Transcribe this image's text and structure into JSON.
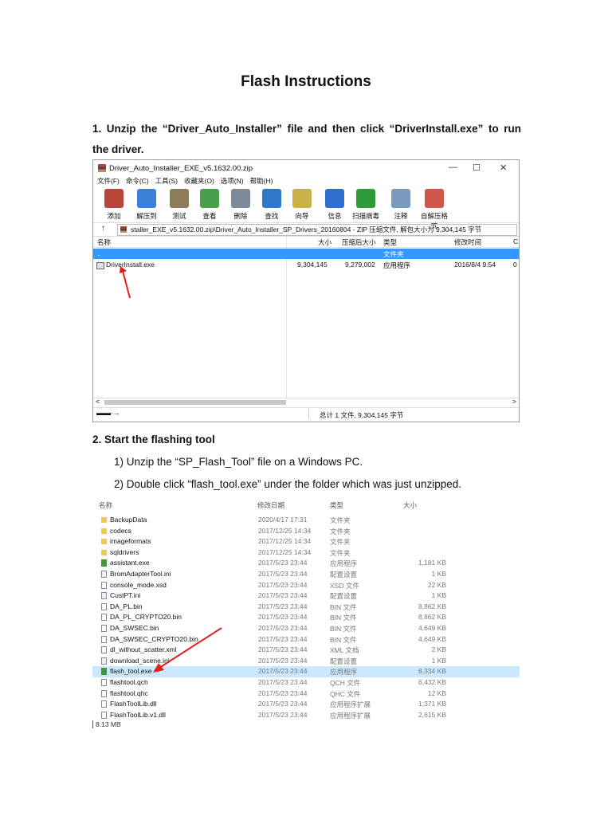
{
  "title": "Flash Instructions",
  "step1": {
    "line1": "1. Unzip the “Driver_Auto_Installer” file and then click “DriverInstall.exe” to run",
    "line2": "the driver."
  },
  "winrar": {
    "window_title": "Driver_Auto_Installer_EXE_v5.1632.00.zip",
    "controls": {
      "minimize": "—",
      "maximize": "☐",
      "close": "✕"
    },
    "menu": [
      "文件(F)",
      "命令(C)",
      "工具(S)",
      "收藏夹(O)",
      "选项(N)",
      "帮助(H)"
    ],
    "toolbar": [
      {
        "label": "添加",
        "icon": "add-archive-icon",
        "color": "#b7463a"
      },
      {
        "label": "解压到",
        "icon": "extract-folder-icon",
        "color": "#3b7fd6"
      },
      {
        "label": "测试",
        "icon": "test-clipboard-icon",
        "color": "#8e7b5a"
      },
      {
        "label": "查看",
        "icon": "view-book-icon",
        "color": "#4aa04a"
      },
      {
        "label": "删除",
        "icon": "delete-trash-icon",
        "color": "#7d8a99"
      },
      {
        "label": "查找",
        "icon": "find-magnifier-icon",
        "color": "#2f78c8"
      },
      {
        "label": "向导",
        "icon": "wizard-wand-icon",
        "color": "#c9b14a"
      },
      {
        "label": "信息",
        "icon": "info-icon",
        "color": "#2f6fd0"
      },
      {
        "label": "扫描病毒",
        "icon": "virus-scan-icon",
        "color": "#2e9b3a"
      },
      {
        "label": "注释",
        "icon": "comment-icon",
        "color": "#7a9bbf"
      },
      {
        "label": "自解压格式",
        "icon": "sfx-icon",
        "color": "#d0564a"
      }
    ],
    "up_arrow": "↑",
    "address": "staller_EXE_v5.1632.00.zip\\Driver_Auto_Installer_SP_Drivers_20160804 - ZIP 压缩文件, 解包大小为 9,304,145 字节",
    "columns": {
      "name": "名称",
      "size": "大小",
      "packed": "压缩后大小",
      "type": "类型",
      "modified": "修改时间",
      "crc": "C"
    },
    "rows": [
      {
        "name": "..",
        "size": "",
        "packed": "",
        "type": "文件夹",
        "modified": "",
        "crc": ""
      },
      {
        "name": "DriverInstall.exe",
        "size": "9,304,145",
        "packed": "9,279,002",
        "type": "应用程序",
        "modified": "2016/8/4 9:54",
        "crc": "0"
      }
    ],
    "scroll_left": "<",
    "scroll_right": ">",
    "drive_icon": "▬▬∙→",
    "status": "总计 1 文件, 9,304,145 字节"
  },
  "step2": {
    "heading": "2.  Start the flashing tool",
    "sub1": "1)  Unzip the “SP_Flash_Tool” file on a Windows PC.",
    "sub2": "2)  Double click “flash_tool.exe” under the folder which was just unzipped."
  },
  "explorer": {
    "columns": {
      "name": "名称",
      "modified": "修改日期",
      "type": "类型",
      "size": "大小"
    },
    "rows": [
      {
        "name": "BackupData",
        "date": "2020/4/17 17:31",
        "type": "文件夹",
        "size": "",
        "kind": "folder"
      },
      {
        "name": "codecs",
        "date": "2017/12/25 14:34",
        "type": "文件夹",
        "size": "",
        "kind": "folder"
      },
      {
        "name": "imageformats",
        "date": "2017/12/25 14:34",
        "type": "文件夹",
        "size": "",
        "kind": "folder"
      },
      {
        "name": "sqldrivers",
        "date": "2017/12/25 14:34",
        "type": "文件夹",
        "size": "",
        "kind": "folder"
      },
      {
        "name": "assistant.exe",
        "date": "2017/5/23 23:44",
        "type": "应用程序",
        "size": "1,181 KB",
        "kind": "exe"
      },
      {
        "name": "BromAdapterTool.ini",
        "date": "2017/5/23 23:44",
        "type": "配置设置",
        "size": "1 KB",
        "kind": "cfg"
      },
      {
        "name": "console_mode.xsd",
        "date": "2017/5/23 23:44",
        "type": "XSD 文件",
        "size": "22 KB",
        "kind": "file"
      },
      {
        "name": "CustPT.ini",
        "date": "2017/5/23 23:44",
        "type": "配置设置",
        "size": "1 KB",
        "kind": "cfg"
      },
      {
        "name": "DA_PL.bin",
        "date": "2017/5/23 23:44",
        "type": "BIN 文件",
        "size": "8,862 KB",
        "kind": "file"
      },
      {
        "name": "DA_PL_CRYPTO20.bin",
        "date": "2017/5/23 23:44",
        "type": "BIN 文件",
        "size": "8,862 KB",
        "kind": "file"
      },
      {
        "name": "DA_SWSEC.bin",
        "date": "2017/5/23 23:44",
        "type": "BIN 文件",
        "size": "4,649 KB",
        "kind": "file"
      },
      {
        "name": "DA_SWSEC_CRYPTO20.bin",
        "date": "2017/5/23 23:44",
        "type": "BIN 文件",
        "size": "4,649 KB",
        "kind": "file"
      },
      {
        "name": "dl_without_scatter.xml",
        "date": "2017/5/23 23:44",
        "type": "XML 文档",
        "size": "2 KB",
        "kind": "file"
      },
      {
        "name": "download_scene.ini",
        "date": "2017/5/23 23:44",
        "type": "配置设置",
        "size": "1 KB",
        "kind": "cfg"
      },
      {
        "name": "flash_tool.exe",
        "date": "2017/5/23 23:44",
        "type": "应用程序",
        "size": "8,334 KB",
        "kind": "exe",
        "selected": true
      },
      {
        "name": "flashtool.qch",
        "date": "2017/5/23 23:44",
        "type": "QCH 文件",
        "size": "6,432 KB",
        "kind": "file"
      },
      {
        "name": "flashtool.qhc",
        "date": "2017/5/23 23:44",
        "type": "QHC 文件",
        "size": "12 KB",
        "kind": "file"
      },
      {
        "name": "FlashToolLib.dll",
        "date": "2017/5/23 23:44",
        "type": "应用程序扩展",
        "size": "1,371 KB",
        "kind": "file"
      },
      {
        "name": "FlashToolLib.v1.dll",
        "date": "2017/5/23 23:44",
        "type": "应用程序扩展",
        "size": "2,615 KB",
        "kind": "file"
      }
    ],
    "footer": "8.13 MB"
  },
  "colors": {
    "selection_blue": "#3399ff",
    "explorer_selection": "#cce8ff",
    "arrow_red": "#e02020"
  }
}
